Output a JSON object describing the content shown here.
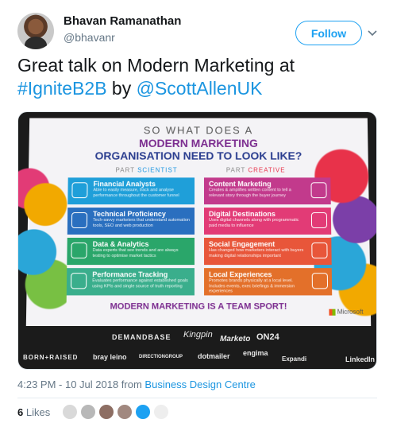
{
  "author": {
    "name": "Bhavan Ramanathan",
    "handle": "@bhavanr",
    "follow_label": "Follow"
  },
  "tweet": {
    "text_part1": "Great talk on Modern Marketing at ",
    "hashtag": "#IgniteB2B",
    "text_part2": " by ",
    "mention": "@ScottAllenUK"
  },
  "slide": {
    "question_line1": "SO WHAT DOES A",
    "question_line2": "MODERN MARKETING",
    "question_line3": "ORGANISATION NEED TO LOOK LIKE?",
    "part_left_prefix": "PART ",
    "part_left_word": "SCIENTIST",
    "part_right_prefix": "PART ",
    "part_right_word": "CREATIVE",
    "left_cards": [
      {
        "title": "Financial Analysts",
        "desc": "Able to easily measure, track and analyse performance throughout the customer funnel"
      },
      {
        "title": "Technical Proficiency",
        "desc": "Tech-savvy marketers that understand automation tools, SEO and web production"
      },
      {
        "title": "Data & Analytics",
        "desc": "Data experts that see trends and are always testing to optimise market tactics"
      },
      {
        "title": "Performance Tracking",
        "desc": "Evaluates performance against established goals using KPIs and single source of truth reporting"
      }
    ],
    "right_cards": [
      {
        "title": "Content Marketing",
        "desc": "Creates & amplifies written content to tell a relevant story through the buyer journey"
      },
      {
        "title": "Digital Destinations",
        "desc": "Uses digital channels along with programmatic paid media to influence"
      },
      {
        "title": "Social Engagement",
        "desc": "Has changed how marketers interact with buyers making digital relationships important"
      },
      {
        "title": "Local Experiences",
        "desc": "Promotes brands physically at a local level. Includes events, exec briefings & immersion experiences"
      }
    ],
    "footer": "MODERN MARKETING IS A TEAM SPORT!",
    "brand": "Microsoft"
  },
  "sponsors": [
    "DEMANDBASE",
    "Kingpin",
    "Marketo",
    "ON24",
    "BORN+RAISED",
    "bray leino",
    "DIRECTIONGROUP",
    "dotmailer",
    "engima",
    "Expandi",
    "LinkedIn"
  ],
  "meta": {
    "timestamp": "4:23 PM - 10 Jul 2018 from ",
    "source": "Business Design Centre"
  },
  "likes": {
    "count": "6",
    "label": " Likes"
  },
  "colors": {
    "link": "#1b95e0",
    "card_left": [
      "#1f9fd9",
      "#2a6fbf",
      "#2aa66a",
      "#3aae8c"
    ],
    "card_right": [
      "#c23a8c",
      "#e23b76",
      "#e8563a",
      "#e3702a"
    ]
  }
}
